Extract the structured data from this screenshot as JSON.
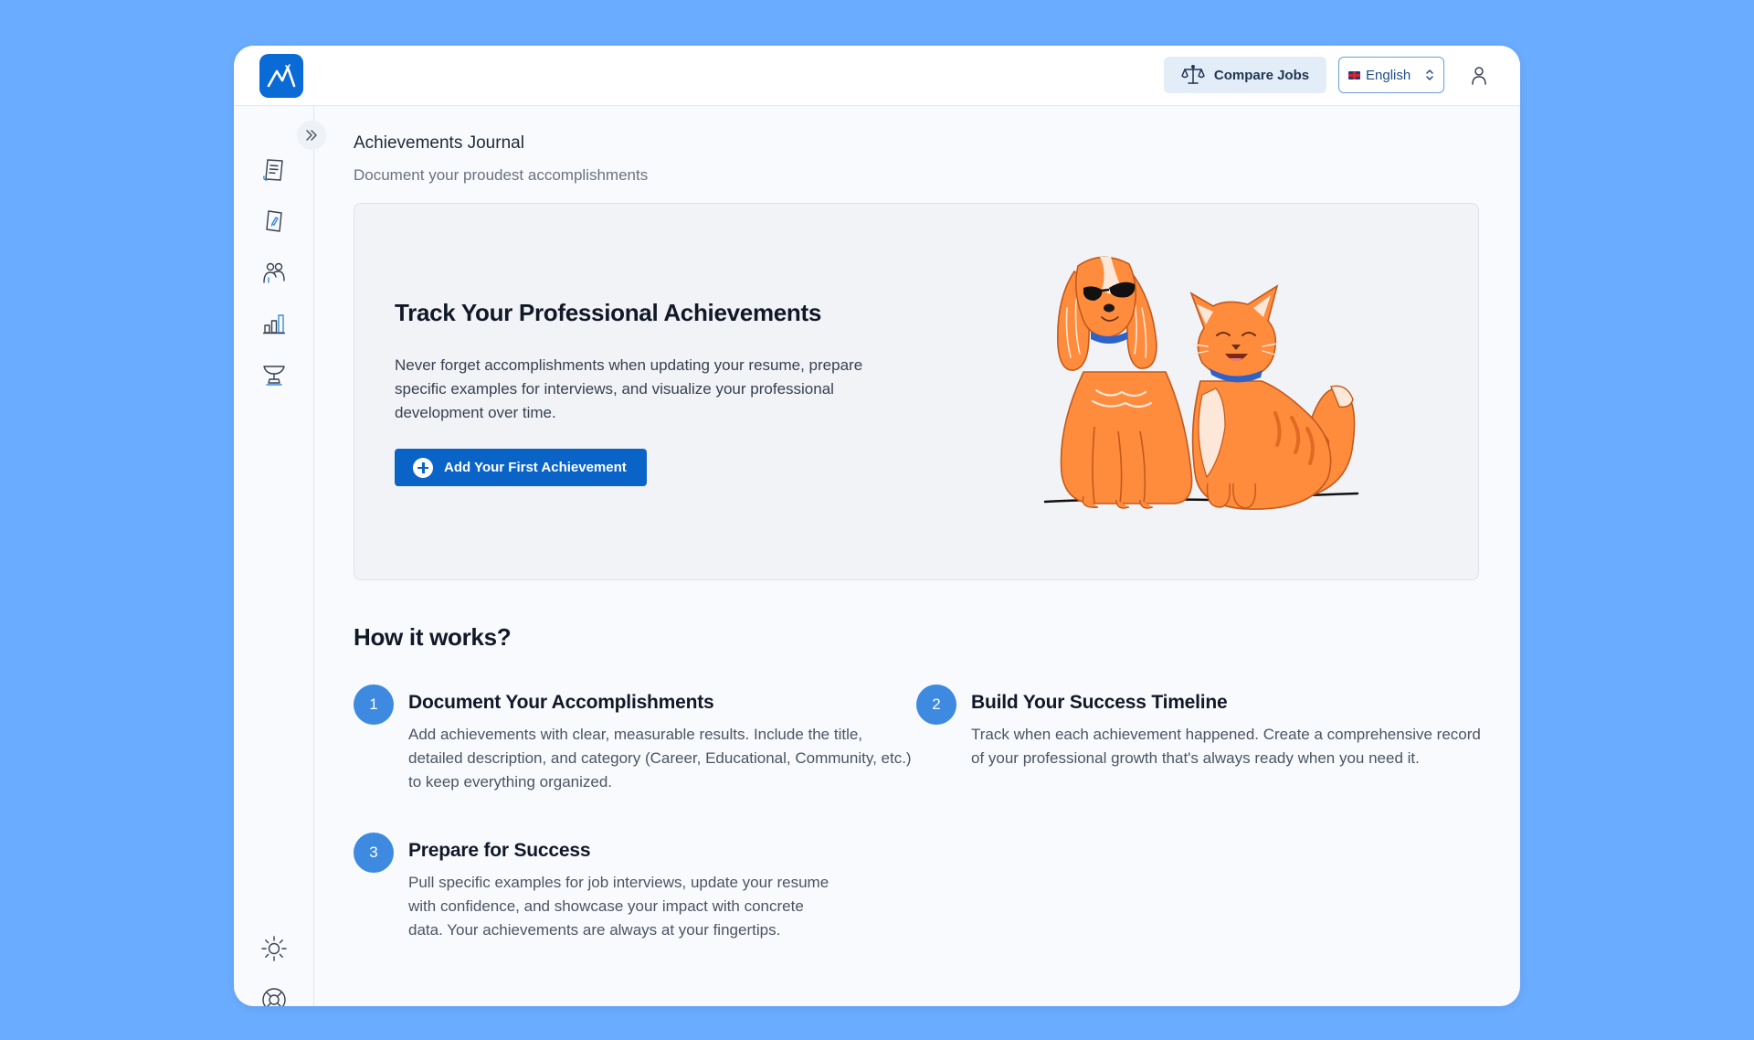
{
  "header": {
    "compare_jobs_label": "Compare Jobs",
    "language": {
      "selected": "English"
    }
  },
  "sidebar": {
    "items": [
      {
        "icon": "resume-document-icon"
      },
      {
        "icon": "cover-letter-icon"
      },
      {
        "icon": "people-icon"
      },
      {
        "icon": "bar-chart-icon"
      },
      {
        "icon": "trophy-icon"
      }
    ],
    "bottom_items": [
      {
        "icon": "sun-icon"
      },
      {
        "icon": "lifebuoy-icon"
      }
    ]
  },
  "page": {
    "title": "Achievements Journal",
    "subtitle": "Document your proudest accomplishments"
  },
  "hero": {
    "title": "Track Your Professional Achievements",
    "text": "Never forget accomplishments when updating your resume, prepare specific examples for interviews, and visualize your professional development over time.",
    "button_label": "Add Your First Achievement"
  },
  "how_it_works": {
    "title": "How it works?",
    "steps": [
      {
        "number": "1",
        "title": "Document Your Accomplishments",
        "description": "Add achievements with clear, measurable results. Include the title, detailed description, and category (Career, Educational, Community, etc.) to keep everything organized."
      },
      {
        "number": "2",
        "title": "Build Your Success Timeline",
        "description": "Track when each achievement happened. Create a comprehensive record of your professional growth that's always ready when you need it."
      },
      {
        "number": "3",
        "title": "Prepare for Success",
        "description": "Pull specific examples for job interviews, update your resume with confidence, and showcase your impact with concrete data. Your achievements are always at your fingertips."
      }
    ]
  },
  "colors": {
    "background": "#6aacff",
    "primary": "#0a64c8",
    "step_badge": "#3d8ae0",
    "illustration_orange": "#ff8b3d"
  }
}
